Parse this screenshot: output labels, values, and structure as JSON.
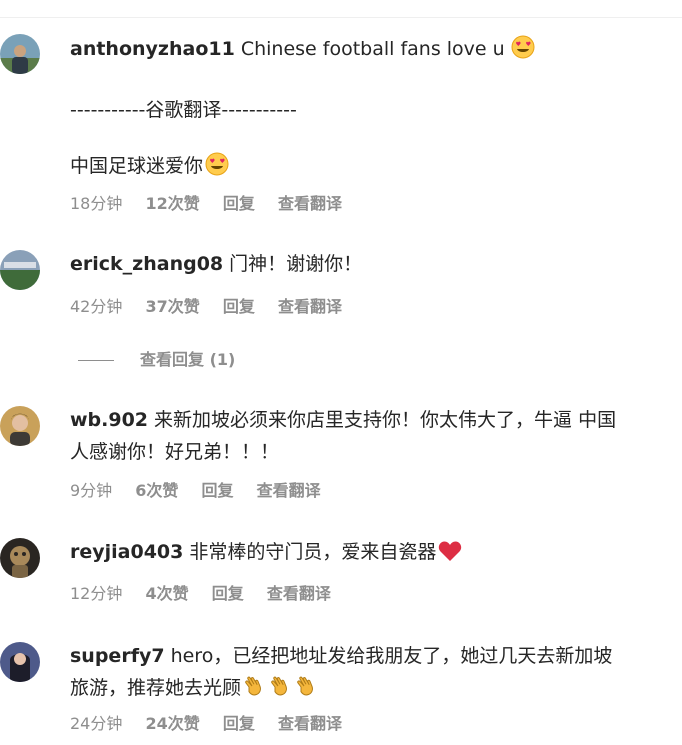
{
  "comments": [
    {
      "username": "anthonyzhao11",
      "text": "Chinese football fans love u",
      "separator": "-----------谷歌翻译-----------",
      "translation": "中国足球迷爱你",
      "time": "18分钟",
      "likes": "12次赞",
      "reply": "回复",
      "see_translation": "查看翻译"
    },
    {
      "username": "erick_zhang08",
      "text": "门神！谢谢你！",
      "time": "42分钟",
      "likes": "37次赞",
      "reply": "回复",
      "see_translation": "查看翻译",
      "view_replies": "查看回复 (1)"
    },
    {
      "username": "wb.902",
      "text_line1": "来新加坡必须来你店里支持你！你太伟大了，牛逼 中国",
      "text_line2": "人感谢你！好兄弟！！！",
      "time": "9分钟",
      "likes": "6次赞",
      "reply": "回复",
      "see_translation": "查看翻译"
    },
    {
      "username": "reyjia0403",
      "text": "非常棒的守门员，爱来自瓷器",
      "time": "12分钟",
      "likes": "4次赞",
      "reply": "回复",
      "see_translation": "查看翻译"
    },
    {
      "username": "superfy7",
      "text_line1": "hero，已经把地址发给我朋友了，她过几天去新加坡",
      "text_line2": "旅游，推荐她去光顾",
      "time": "24分钟",
      "likes": "24次赞",
      "reply": "回复",
      "see_translation": "查看翻译"
    }
  ],
  "icons": {
    "emoji_heart_eyes": "heart-eyes-emoji",
    "emoji_red_heart": "red-heart-emoji",
    "emoji_clap": "clap-emoji"
  }
}
